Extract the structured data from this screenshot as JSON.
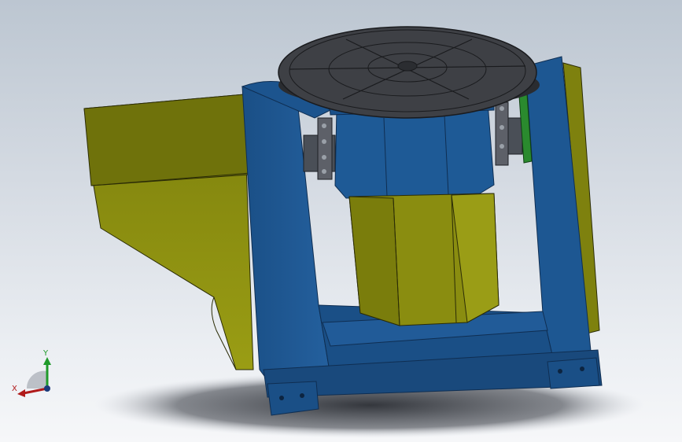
{
  "viewport": {
    "background_top": "#bcc6d1",
    "background_bottom": "#f6f7f9"
  },
  "model": {
    "colors": {
      "frame_blue": "#1e5a96",
      "frame_blue_dark": "#173f6e",
      "housing_olive": "#7a7d0c",
      "housing_olive_light": "#8d9010",
      "table_dark": "#3a3c40",
      "flange_green": "#2a8a2e",
      "shaft_gray": "#4a4f57"
    },
    "icons": [
      "triad-icon"
    ]
  },
  "triad": {
    "x_label": "X",
    "y_label": "Y",
    "x_color": "#b01a1a",
    "y_color": "#1f9a2a"
  }
}
